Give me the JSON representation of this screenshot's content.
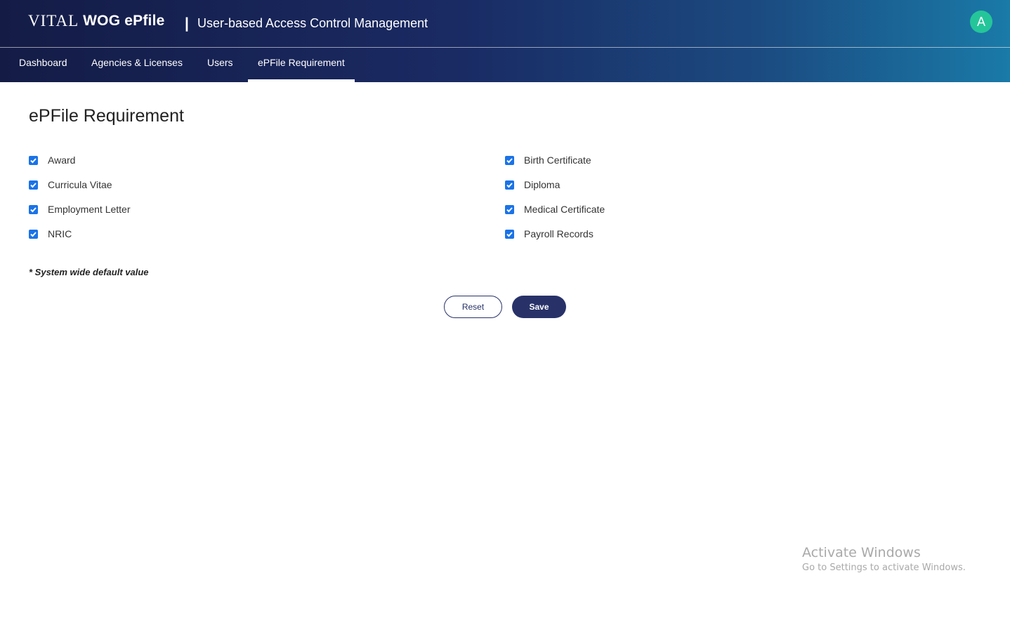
{
  "header": {
    "logo_left": "VITAL",
    "logo_right": "WOG ePfile",
    "separator": "|",
    "app_title": "User-based Access Control Management",
    "avatar_initial": "A",
    "avatar_color": "#25c59a"
  },
  "nav": {
    "items": [
      {
        "label": "Dashboard"
      },
      {
        "label": "Agencies & Licenses"
      },
      {
        "label": "Users"
      },
      {
        "label": "ePFile Requirement",
        "active": true
      }
    ]
  },
  "page": {
    "title": "ePFile Requirement",
    "left_items": [
      {
        "label": "Award",
        "checked": true
      },
      {
        "label": "Curricula Vitae",
        "checked": true
      },
      {
        "label": "Employment Letter",
        "checked": true
      },
      {
        "label": "NRIC",
        "checked": true
      }
    ],
    "right_items": [
      {
        "label": "Birth Certificate",
        "checked": true
      },
      {
        "label": "Diploma",
        "checked": true
      },
      {
        "label": "Medical Certificate",
        "checked": true
      },
      {
        "label": "Payroll Records",
        "checked": true
      }
    ],
    "note": "* System wide default value",
    "reset_label": "Reset",
    "save_label": "Save"
  },
  "colors": {
    "primary": "#283269",
    "checkbox": "#1a73e8"
  },
  "watermark": {
    "title": "Activate Windows",
    "subtitle": "Go to Settings to activate Windows."
  }
}
